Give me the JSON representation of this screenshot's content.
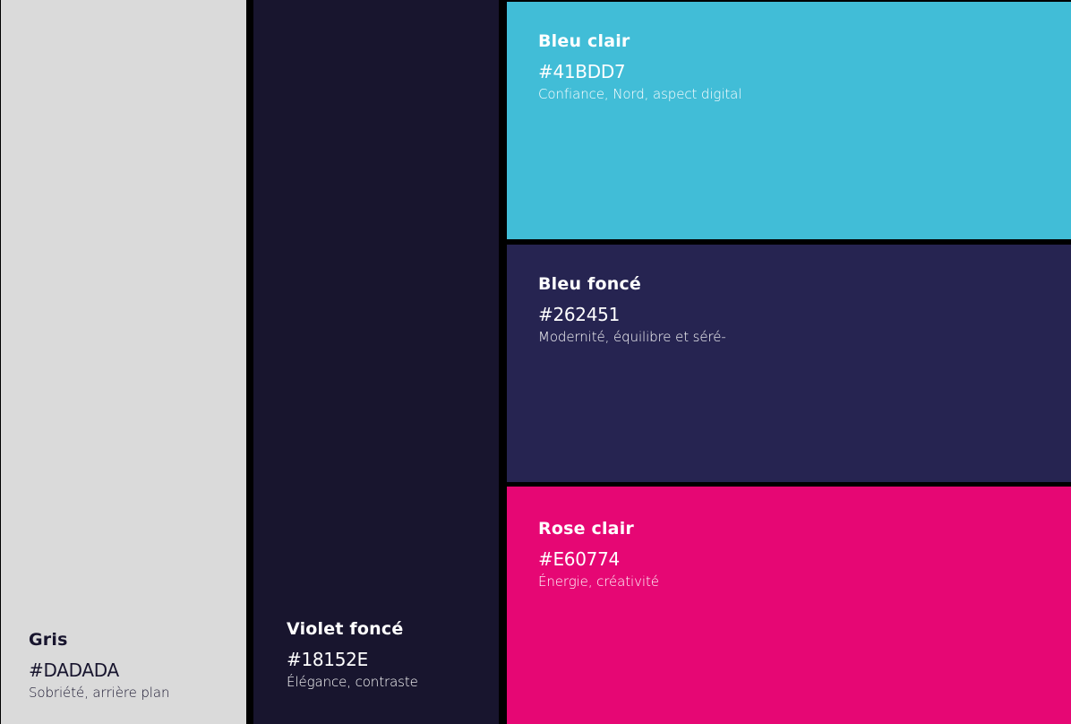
{
  "swatches": {
    "gris": {
      "name": "Gris",
      "hex": "#DADADA",
      "description": "Sobriété, arrière plan",
      "color": "#DADADA"
    },
    "violet_fonce": {
      "name": "Violet foncé",
      "hex": "#18152E",
      "description": "Élégance, contraste",
      "color": "#18152E"
    },
    "bleu_clair": {
      "name": "Bleu clair",
      "hex": "#41BDD7",
      "description": "Confiance, Nord, aspect digital",
      "color": "#41BDD7"
    },
    "bleu_fonce": {
      "name": "Bleu foncé",
      "hex": "#262451",
      "description": "Modernité, équilibre et séré-",
      "color": "#262451"
    },
    "rose_clair": {
      "name": "Rose clair",
      "hex": "#E60774",
      "description": "Énergie, créativité",
      "color": "#E60774"
    }
  }
}
